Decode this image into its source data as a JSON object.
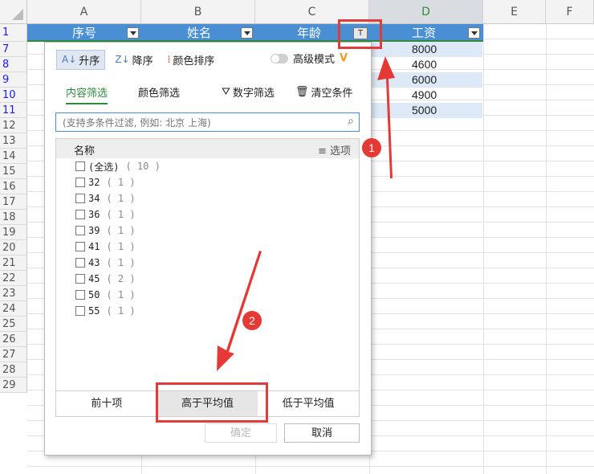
{
  "columns": [
    "A",
    "B",
    "C",
    "D",
    "E",
    "F"
  ],
  "rows": [
    "1",
    "7",
    "8",
    "9",
    "10",
    "11",
    "12",
    "13",
    "14",
    "15",
    "16",
    "17",
    "18",
    "19",
    "20",
    "21",
    "22",
    "23",
    "24",
    "25",
    "26",
    "27",
    "28",
    "29"
  ],
  "header_row": {
    "a": "序号",
    "b": "姓名",
    "c": "年龄",
    "d": "工资"
  },
  "salary_values": [
    "8000",
    "4600",
    "6000",
    "4900",
    "5000"
  ],
  "filter_popup": {
    "sort_asc": "升序",
    "sort_desc": "降序",
    "color_sort": "颜色排序",
    "advanced_mode": "高级模式",
    "tab_content": "内容筛选",
    "tab_color": "颜色筛选",
    "number_filter": "数字筛选",
    "clear_conditions": "清空条件",
    "search_placeholder": "(支持多条件过滤, 例如: 北京 上海)",
    "list_header_name": "名称",
    "list_header_options": "选项",
    "items": [
      {
        "label": "(全选)",
        "count": "( 10 )"
      },
      {
        "label": "32",
        "count": "( 1 )"
      },
      {
        "label": "34",
        "count": "( 1 )"
      },
      {
        "label": "36",
        "count": "( 1 )"
      },
      {
        "label": "39",
        "count": "( 1 )"
      },
      {
        "label": "41",
        "count": "( 1 )"
      },
      {
        "label": "43",
        "count": "( 1 )"
      },
      {
        "label": "45",
        "count": "( 2 )"
      },
      {
        "label": "50",
        "count": "( 1 )"
      },
      {
        "label": "55",
        "count": "( 1 )"
      }
    ],
    "top_ten": "前十项",
    "above_average": "高于平均值",
    "below_average": "低于平均值",
    "ok": "确定",
    "cancel": "取消"
  },
  "annotations": {
    "step1": "1",
    "step2": "2"
  },
  "colors": {
    "accent_green": "#2f8a3c",
    "header_blue": "#4a8fd4",
    "annotation_red": "#e23b3b"
  }
}
